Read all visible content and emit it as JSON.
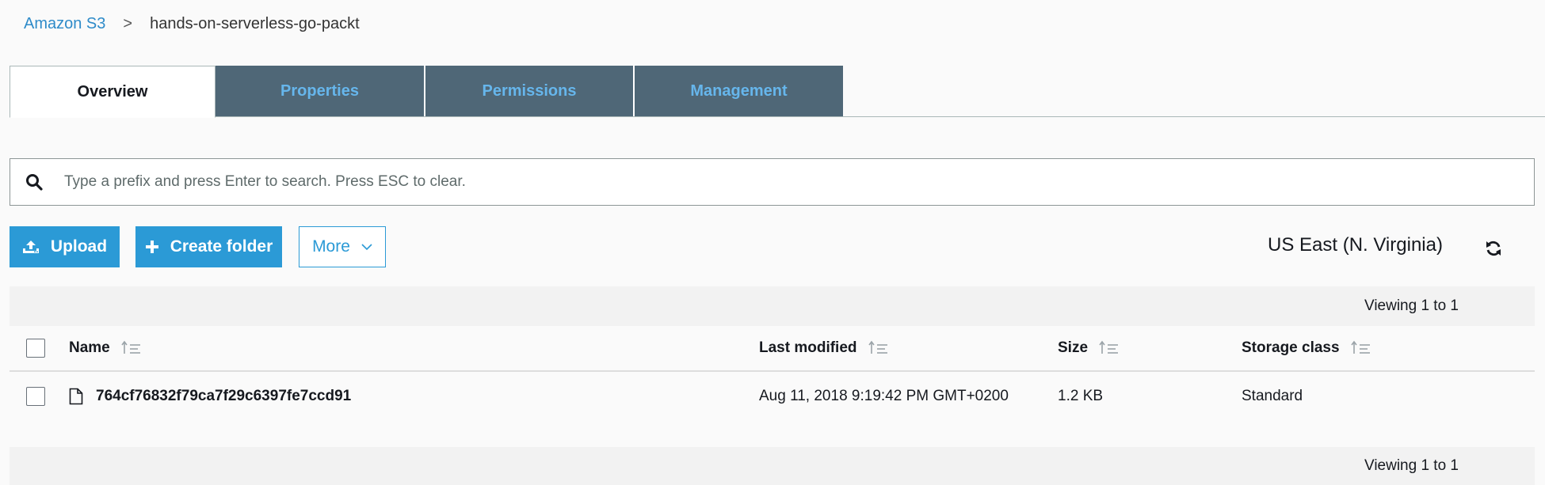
{
  "breadcrumb": {
    "root": "Amazon S3",
    "separator": ">",
    "current": "hands-on-serverless-go-packt"
  },
  "tabs": [
    {
      "label": "Overview",
      "active": true
    },
    {
      "label": "Properties",
      "active": false
    },
    {
      "label": "Permissions",
      "active": false
    },
    {
      "label": "Management",
      "active": false
    }
  ],
  "search": {
    "placeholder": "Type a prefix and press Enter to search. Press ESC to clear.",
    "value": "",
    "icon": "search-icon"
  },
  "actions": {
    "upload_label": "Upload",
    "create_folder_label": "Create folder",
    "more_label": "More"
  },
  "region": "US East (N. Virginia)",
  "viewing": {
    "top": "Viewing 1 to 1",
    "bottom": "Viewing 1 to 1"
  },
  "table": {
    "columns": [
      "Name",
      "Last modified",
      "Size",
      "Storage class"
    ],
    "rows": [
      {
        "name": "764cf76832f79ca7f29c6397fe7ccd91",
        "last_modified": "Aug 11, 2018 9:19:42 PM GMT+0200",
        "size": "1.2 KB",
        "storage_class": "Standard"
      }
    ]
  },
  "colors": {
    "accent": "#2b9ad6",
    "tab_inactive_bg": "#4f6777",
    "tab_inactive_text": "#66b6ec",
    "link": "#2e8bc9"
  }
}
